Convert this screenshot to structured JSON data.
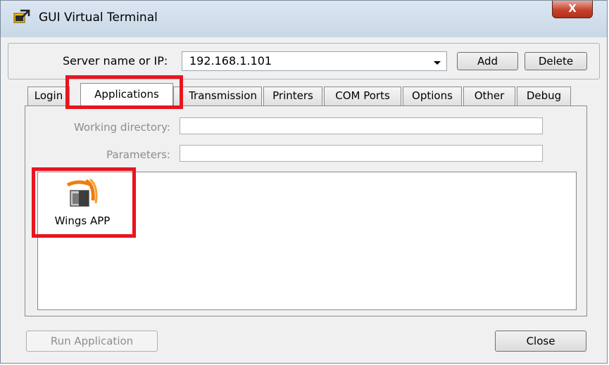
{
  "window": {
    "title": "GUI Virtual Terminal",
    "close_glyph": "X",
    "app_icon": "terminal-app-icon"
  },
  "server": {
    "label": "Server name or IP:",
    "value": "192.168.1.101",
    "add_label": "Add",
    "delete_label": "Delete"
  },
  "tabs": [
    {
      "label": "Login",
      "active": false
    },
    {
      "label": "Applications",
      "active": true
    },
    {
      "label": "Transmission",
      "active": false
    },
    {
      "label": "Printers",
      "active": false
    },
    {
      "label": "COM Ports",
      "active": false
    },
    {
      "label": "Options",
      "active": false
    },
    {
      "label": "Other",
      "active": false
    },
    {
      "label": "Debug",
      "active": false
    }
  ],
  "applications": {
    "working_directory_label": "Working directory:",
    "working_directory_value": "",
    "parameters_label": "Parameters:",
    "parameters_value": "",
    "items": [
      {
        "label": "Wings APP",
        "icon": "wings-app-icon"
      }
    ]
  },
  "footer": {
    "run_label": "Run Application",
    "close_label": "Close"
  },
  "annotation": {
    "highlight_color": "#e8141e"
  }
}
